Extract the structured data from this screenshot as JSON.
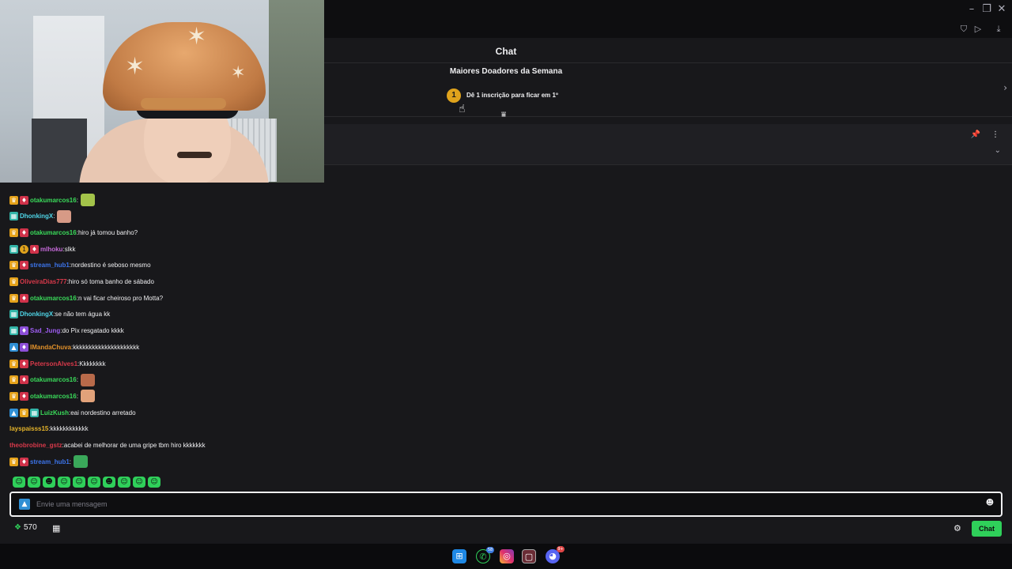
{
  "header": {
    "chat_title": "Chat"
  },
  "leaderboard": {
    "title": "Maiores Doadores da Semana",
    "rank_badge": "1",
    "cta_text": "Dê 1 inscrição para ficar em 1º"
  },
  "messages": [
    {
      "user": "otakumarcos16",
      "color": "#3adb5a",
      "text": "",
      "badges": [
        "crown",
        "sub"
      ],
      "emote": "#a3c34a"
    },
    {
      "user": "DhonkingX",
      "color": "#4fd6e8",
      "text": "",
      "badges": [
        "grid"
      ],
      "emote": "#d79a86"
    },
    {
      "user": "otakumarcos16",
      "color": "#3adb5a",
      "text": "hiro já tomou banho?",
      "badges": [
        "crown",
        "sub"
      ]
    },
    {
      "user": "mlhoku",
      "color": "#c56ad8",
      "text": "slkk",
      "badges": [
        "grid",
        "gold",
        "sub"
      ]
    },
    {
      "user": "stream_hub1",
      "color": "#3c74ea",
      "text": "nordestino é seboso mesmo",
      "badges": [
        "crown",
        "sub"
      ]
    },
    {
      "user": "OliveiraDias777",
      "color": "#d8394a",
      "text": "hiro só toma banho de sábado",
      "badges": [
        "crown"
      ]
    },
    {
      "user": "otakumarcos16",
      "color": "#3adb5a",
      "text": "n vai ficar cheiroso pro Motta?",
      "badges": [
        "crown",
        "sub"
      ]
    },
    {
      "user": "DhonkingX",
      "color": "#4fd6e8",
      "text": "se não tem água kk",
      "badges": [
        "grid"
      ]
    },
    {
      "user": "Sad_Jung",
      "color": "#9d5cf0",
      "text": "do Pix resgatado kkkk",
      "badges": [
        "grid",
        "purple"
      ]
    },
    {
      "user": "IMandaChuva",
      "color": "#e0902a",
      "text": "kkkkkkkkkkkkkkkkkkkkk",
      "badges": [
        "prime",
        "purple"
      ]
    },
    {
      "user": "PetersonAlves1",
      "color": "#d8394a",
      "text": "Kkkkkkkk",
      "badges": [
        "crown",
        "sub"
      ]
    },
    {
      "user": "otakumarcos16",
      "color": "#3adb5a",
      "text": "",
      "badges": [
        "crown",
        "sub"
      ],
      "emote": "#b86a4a"
    },
    {
      "user": "otakumarcos16",
      "color": "#3adb5a",
      "text": "",
      "badges": [
        "crown",
        "sub"
      ],
      "emote": "#e2a27a"
    },
    {
      "user": "LuizKush",
      "color": "#3adb5a",
      "text": "eai nordestino arretado",
      "badges": [
        "prime",
        "crown",
        "grid"
      ]
    },
    {
      "user": "layspaisss15",
      "color": "#e5b42a",
      "text": "kkkkkkkkkkkk",
      "badges": []
    },
    {
      "user": "theobrobine_gstz",
      "color": "#d8394a",
      "text": "acabei de melhorar de uma gripe tbm hiro kkkkkkk",
      "badges": []
    },
    {
      "user": "stream_hub1",
      "color": "#3c74ea",
      "text": "",
      "badges": [
        "crown",
        "sub"
      ],
      "emote": "#3aa85a"
    }
  ],
  "input": {
    "placeholder": "Envie uma mensagem"
  },
  "footer": {
    "points": "570",
    "chat_button": "Chat"
  },
  "taskbar": {
    "whatsapp_badge": "58",
    "discord_badge": "9+"
  }
}
